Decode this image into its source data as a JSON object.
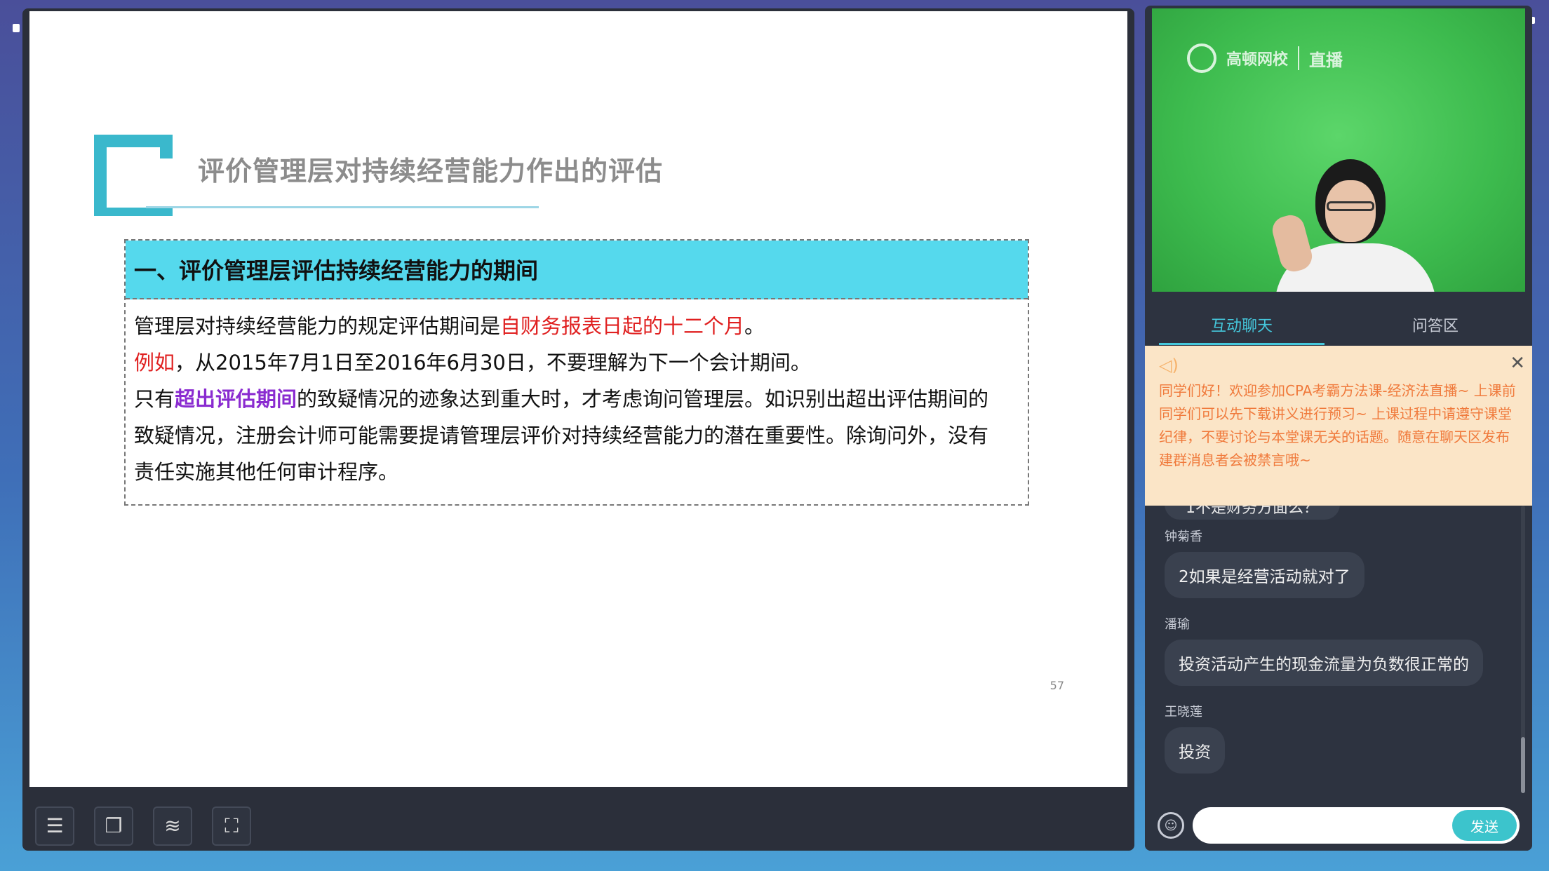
{
  "slide": {
    "title": "评价管理层对持续经营能力作出的评估",
    "section_heading": "一、评价管理层评估持续经营能力的期间",
    "p1_a": "管理层对持续经营能力的规定评估期间是",
    "p1_red": "自财务报表日起的十二个月",
    "p1_end": "。",
    "p2_red": "例如",
    "p2_rest": "，从2015年7月1日至2016年6月30日，不要理解为下一个会计期间。",
    "p3_a": "只有",
    "p3_purple": "超出评估期间",
    "p3_b": "的致疑情况的迹象达到重大时，才考虑询问管理层。如识别出超出评估期间的",
    "p4": "致疑情况，注册会计师可能需要提请管理层评价对持续经营能力的潜在重要性。除询问外，没有",
    "p5": "责任实施其他任何审计程序。",
    "page_number": "57"
  },
  "toolbar": {
    "icons": [
      "list-icon",
      "copy-icon",
      "wifi-icon",
      "fullscreen-icon"
    ]
  },
  "video": {
    "brand": "高顿网校",
    "live_label": "直播"
  },
  "tabs": {
    "chat": "互动聊天",
    "qa": "问答区"
  },
  "notice": {
    "text": "同学们好！欢迎参加CPA考霸方法课-经济法直播~ 上课前同学们可以先下载讲义进行预习~ 上课过程中请遵守课堂纪律，不要讨论与本堂课无关的话题。随意在聊天区发布建群消息者会被禁言哦~"
  },
  "chat": {
    "partial_message": "1不是财务方面么？",
    "messages": [
      {
        "name": "钟菊香",
        "text": "2如果是经营活动就对了"
      },
      {
        "name": "潘瑜",
        "text": "投资活动产生的现金流量为负数很正常的"
      },
      {
        "name": "王晓莲",
        "text": "投资"
      }
    ]
  },
  "input": {
    "send_label": "发送",
    "placeholder": ""
  },
  "colors": {
    "accent": "#45c8dc",
    "section_bg": "#55d9ed",
    "highlight_red": "#e02020",
    "highlight_purple": "#8a2bd0",
    "notice_bg": "#fbe5c7",
    "notice_text": "#f07a3c"
  }
}
